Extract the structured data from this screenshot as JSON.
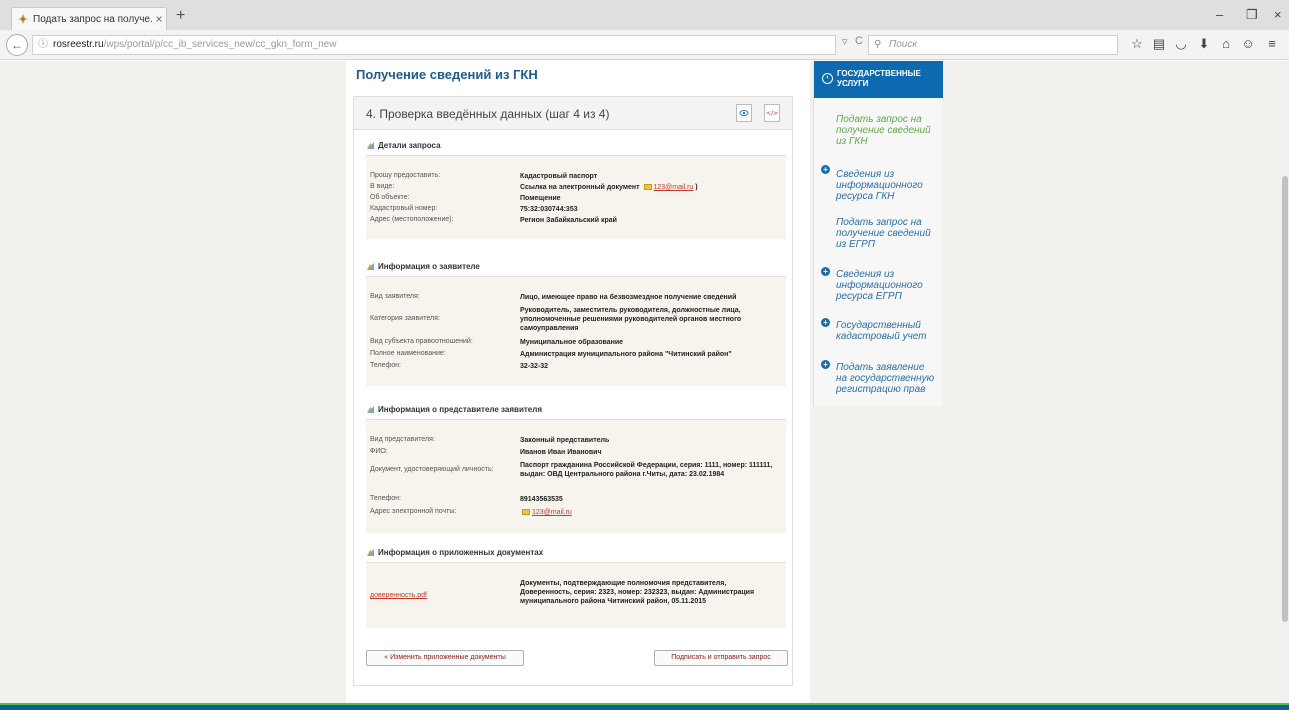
{
  "browser": {
    "tab_title": "Подать запрос на получе...",
    "tab_close": "×",
    "new_tab": "+",
    "url_host": "rosreestr.ru",
    "url_path": "/wps/portal/p/cc_ib_services_new/cc_gkn_form_new",
    "search_placeholder": "Поиск",
    "win_min": "–",
    "win_max": "❐",
    "win_close": "×"
  },
  "page": {
    "title": "Получение сведений из ГКН",
    "step_title": "4. Проверка введённых данных (шаг 4 из 4)"
  },
  "sections": {
    "request": {
      "title": "Детали запроса",
      "rows": [
        {
          "label": "Прошу предоставить:",
          "value": "Кадастровый паспорт"
        },
        {
          "label": "В виде:",
          "value": "Ссылка на электронный документ",
          "email": "123@mail.ru",
          "suffix": ")"
        },
        {
          "label": "Об объекте:",
          "value": "Помещение"
        },
        {
          "label": "Кадастровый номер:",
          "value": "75:32:030744:353"
        },
        {
          "label": "Адрес (местоположение):",
          "value": "Регион Забайкальский край"
        }
      ]
    },
    "applicant": {
      "title": "Информация о заявителе",
      "rows": [
        {
          "label": "Вид заявителя:",
          "value": "Лицо, имеющее право на безвозмездное получение сведений"
        },
        {
          "label": "Категория заявителя:",
          "value": "Руководитель, заместитель руководителя, должностные лица, уполномоченные решениями руководителей органов местного самоуправления"
        },
        {
          "label": "Вид субъекта правоотношений:",
          "value": "Муниципальное образование"
        },
        {
          "label": "Полное наименование:",
          "value": "Администрация муниципального района \"Читинский район\""
        },
        {
          "label": "Телефон:",
          "value": "32-32-32"
        }
      ]
    },
    "representative": {
      "title": "Информация о представителе заявителя",
      "rows": [
        {
          "label": "Вид представителя:",
          "value": "Законный представитель"
        },
        {
          "label": "ФИО:",
          "value": "Иванов Иван Иванович"
        },
        {
          "label": "Документ, удостоверяющий личность:",
          "value": "Паспорт гражданина Российской Федерации, серия: 1111, номер: 111111, выдан: ОВД Центрального района г.Читы, дата: 23.02.1984"
        },
        {
          "label": "Телефон:",
          "value": "89143563535"
        },
        {
          "label": "Адрес электронной почты:",
          "email": "123@mail.ru"
        }
      ]
    },
    "documents": {
      "title": "Информация о приложенных документах",
      "file": "доверенность.pdf",
      "description": "Документы, подтверждающие полномочия представителя, Доверенность, серия: 2323, номер: 232323, выдан: Администрация муниципального района Читинский район, 05.11.2015"
    }
  },
  "buttons": {
    "change_docs": "« Изменить приложенные документы",
    "submit": "Подписать и отправить запрос"
  },
  "sidebar": {
    "header": "ГОСУДАРСТВЕННЫЕ УСЛУГИ",
    "items": [
      {
        "label": "Подать запрос на получение сведений из ГКН",
        "active": true
      },
      {
        "label": "Сведения из информационного ресурса ГКН"
      },
      {
        "label": "Подать запрос на получение сведений из ЕГРП"
      },
      {
        "label": "Сведения из информационного ресурса ЕГРП"
      },
      {
        "label": "Государственный кадастровый учет"
      },
      {
        "label": "Подать заявление на государственную регистрацию прав"
      }
    ]
  },
  "colors": {
    "accent": "#0e6ab0",
    "title": "#1b5d8c",
    "active_item": "#63a84a",
    "link": "#c0392b"
  }
}
